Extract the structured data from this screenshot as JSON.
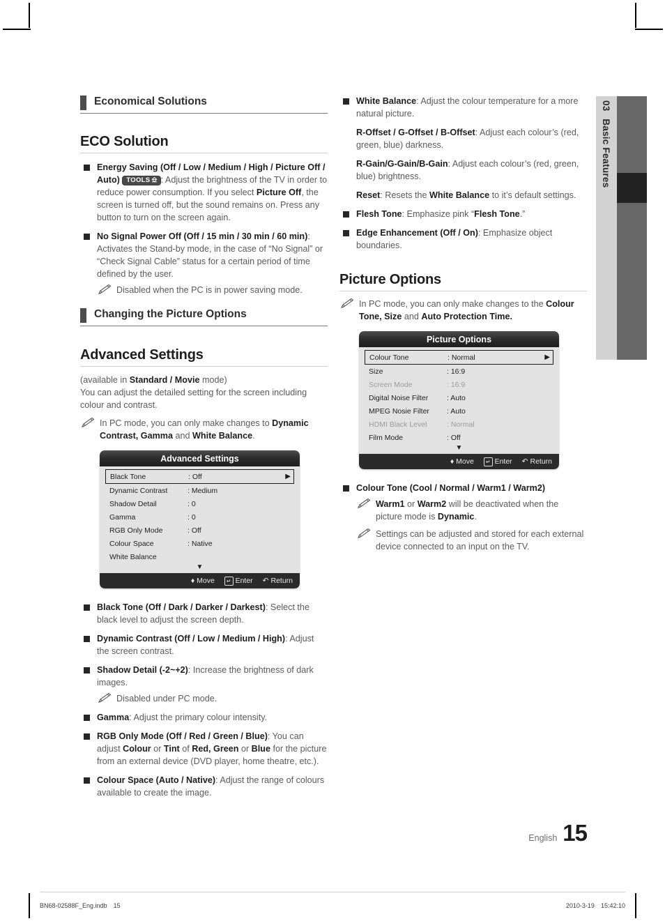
{
  "chapter_tab": {
    "number": "03",
    "title": "Basic Features"
  },
  "left_column": {
    "section1_heading": "Economical Solutions",
    "heading1": "ECO Solution",
    "bullets": [
      {
        "bold_lead": "Energy Saving (Off / Low / Medium / High / Picture Off / Auto)",
        "badge": "TOOLS",
        "text_after": ": Adjust the brightness of the TV in order to reduce power consumption. If you select ",
        "bold_mid": "Picture Off",
        "text_end": ", the screen is turned off, but the sound remains on. Press any button to turn on the screen again."
      },
      {
        "bold_lead": "No Signal Power Off (Off / 15 min / 30 min / 60 min)",
        "text_after": ": Activates the Stand-by mode, in the case of “No Signal” or “Check Signal Cable” status for a certain period of time defined by the user.",
        "note": "Disabled when the PC is in power saving mode."
      }
    ],
    "section2_heading": "Changing the Picture Options",
    "heading2": "Advanced Settings",
    "intro_line1_prefix": "(available in ",
    "intro_line1_bold": "Standard / Movie",
    "intro_line1_suffix": " mode)",
    "intro_line2": "You can adjust the detailed setting for the screen including colour and contrast.",
    "intro_note_prefix": "In PC mode, you can only make changes to ",
    "intro_note_bold": "Dynamic Contrast, Gamma",
    "intro_note_mid": " and ",
    "intro_note_bold2": "White Balance",
    "intro_note_suffix": ".",
    "osd": {
      "title": "Advanced Settings",
      "rows": [
        {
          "label": "Black Tone",
          "value": ": Off",
          "selected": true,
          "dim": false,
          "arrow": "▶"
        },
        {
          "label": "Dynamic Contrast",
          "value": ": Medium",
          "selected": false,
          "dim": false,
          "arrow": ""
        },
        {
          "label": "Shadow Detail",
          "value": ": 0",
          "selected": false,
          "dim": false,
          "arrow": ""
        },
        {
          "label": "Gamma",
          "value": ": 0",
          "selected": false,
          "dim": false,
          "arrow": ""
        },
        {
          "label": "RGB Only Mode",
          "value": ": Off",
          "selected": false,
          "dim": false,
          "arrow": ""
        },
        {
          "label": "Colour Space",
          "value": ": Native",
          "selected": false,
          "dim": false,
          "arrow": ""
        },
        {
          "label": "White Balance",
          "value": "",
          "selected": false,
          "dim": false,
          "arrow": ""
        }
      ],
      "more_glyph": "▼",
      "footer": {
        "move": "Move",
        "enter": "Enter",
        "return": "Return"
      }
    },
    "bullets2": [
      {
        "bold_lead": "Black Tone (Off / Dark / Darker / Darkest)",
        "text_after": ": Select the black level to adjust the screen depth."
      },
      {
        "bold_lead": "Dynamic Contrast (Off / Low / Medium / High)",
        "text_after": ": Adjust the screen contrast."
      },
      {
        "bold_lead": "Shadow Detail (-2~+2)",
        "text_after": ": Increase the brightness of dark images.",
        "note": "Disabled under PC mode."
      },
      {
        "bold_lead": "Gamma",
        "text_after": ": Adjust the primary colour intensity."
      },
      {
        "bold_lead": "RGB Only Mode (Off / Red / Green / Blue)",
        "text_after": ": You can adjust ",
        "inline_bolds": [
          "Colour",
          "Tint",
          "Red, Green",
          "Blue"
        ],
        "text_parts": [
          " or ",
          " of ",
          " or ",
          " for the picture from an external device (DVD player, home theatre, etc.)."
        ]
      },
      {
        "bold_lead": "Colour Space (Auto / Native)",
        "text_after": ": Adjust the range of colours available to create the image."
      }
    ]
  },
  "right_column": {
    "bullets_top": [
      {
        "bold_lead": "White Balance",
        "text_after": ": Adjust the colour temperature for a more natural picture.",
        "sub": [
          {
            "bold": "R-Offset / G-Offset / B-Offset",
            "text": ": Adjust each colour’s (red, green, blue) darkness."
          },
          {
            "bold": "R-Gain/G-Gain/B-Gain",
            "text": ": Adjust each colour’s (red, green, blue) brightness."
          },
          {
            "bold": "Reset",
            "text": ": Resets the ",
            "bold2": "White Balance",
            "text2": " to it’s default settings."
          }
        ]
      },
      {
        "bold_lead": "Flesh Tone",
        "text_after": ": Emphasize pink “",
        "bold_mid": "Flesh Tone",
        "text_end": ".”"
      },
      {
        "bold_lead": "Edge Enhancement (Off / On)",
        "text_after": ": Emphasize object boundaries."
      }
    ],
    "heading": "Picture Options",
    "note_prefix": "In PC mode, you can only make changes to the ",
    "note_bold": "Colour Tone, Size",
    "note_mid": " and ",
    "note_bold2": "Auto Protection Time.",
    "osd": {
      "title": "Picture Options",
      "rows": [
        {
          "label": "Colour Tone",
          "value": ": Normal",
          "selected": true,
          "dim": false,
          "arrow": "▶"
        },
        {
          "label": "Size",
          "value": ": 16:9",
          "selected": false,
          "dim": false,
          "arrow": ""
        },
        {
          "label": "Screen Mode",
          "value": ": 16:9",
          "selected": false,
          "dim": true,
          "arrow": ""
        },
        {
          "label": "Digital Noise Filter",
          "value": ": Auto",
          "selected": false,
          "dim": false,
          "arrow": ""
        },
        {
          "label": "MPEG Nosie Filter",
          "value": ": Auto",
          "selected": false,
          "dim": false,
          "arrow": ""
        },
        {
          "label": "HDMI Black Level",
          "value": ": Normal",
          "selected": false,
          "dim": true,
          "arrow": ""
        },
        {
          "label": "Film Mode",
          "value": ": Off",
          "selected": false,
          "dim": false,
          "arrow": ""
        }
      ],
      "more_glyph": "▼",
      "footer": {
        "move": "Move",
        "enter": "Enter",
        "return": "Return"
      }
    },
    "bullets_bottom": [
      {
        "bold_lead": "Colour Tone (Cool / Normal / Warm1 / Warm2)",
        "notes": [
          {
            "bold": "Warm1",
            "text": " or ",
            "bold2": "Warm2",
            "text2": " will be deactivated when the picture mode is ",
            "bold3": "Dynamic",
            "text3": "."
          },
          {
            "plain": "Settings can be adjusted and stored for each external device connected to an input on the TV."
          }
        ]
      }
    ]
  },
  "page_footer": {
    "language": "English",
    "page_number": "15",
    "file_name": "BN68-02588F_Eng.indb",
    "file_page": "15",
    "date": "2010-3-19",
    "time": "15:42:10"
  }
}
